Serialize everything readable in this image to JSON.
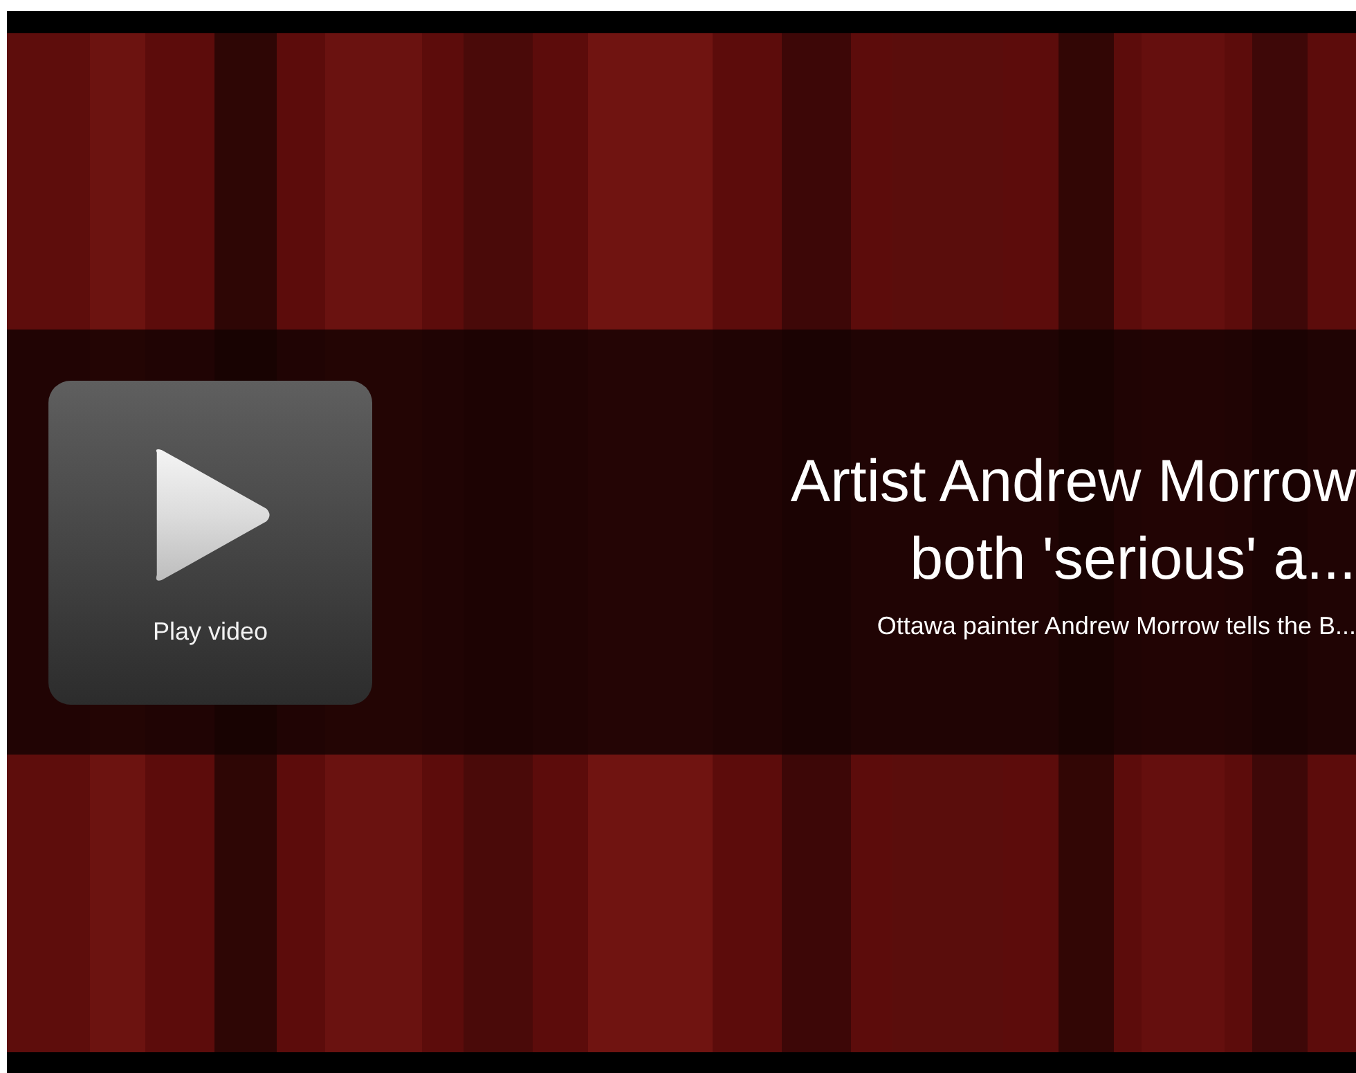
{
  "video": {
    "kind": "picture",
    "play_button": {
      "label": "Play video"
    },
    "title": "Artist Andrew Morrow both 'serious' a...",
    "description": "Ottawa painter Andrew Morrow tells the B..."
  }
}
